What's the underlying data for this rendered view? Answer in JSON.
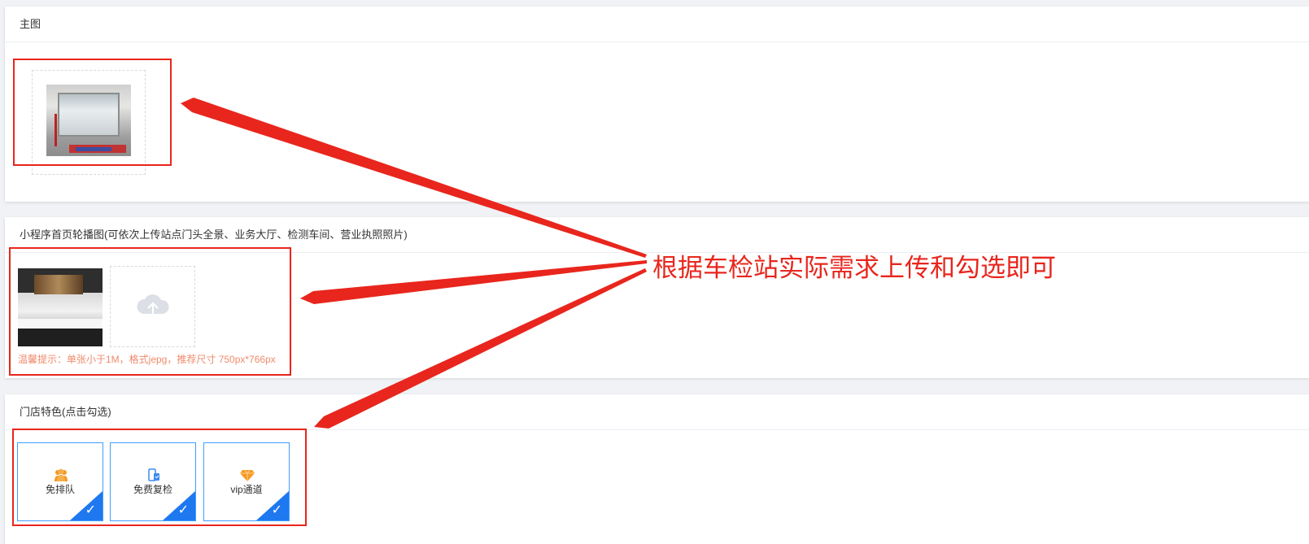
{
  "sections": {
    "main_image": {
      "title": "主图"
    },
    "carousel": {
      "title": "小程序首页轮播图(可依次上传站点门头全景、业务大厅、检测车间、营业执照照片)",
      "hint": "温馨提示：单张小于1M，格式jepg，推荐尺寸 750px*766px"
    },
    "features": {
      "title": "门店特色(点击勾选)",
      "items": [
        {
          "label": "免排队",
          "icon": "people-icon",
          "checked": true
        },
        {
          "label": "免费复检",
          "icon": "phone-document-icon",
          "checked": true
        },
        {
          "label": "vip通道",
          "icon": "diamond-icon",
          "checked": true
        }
      ]
    }
  },
  "annotation": {
    "text": "根据车检站实际需求上传和勾选即可",
    "color": "#e8261d"
  },
  "colors": {
    "accent": "#1e78f0",
    "hint": "#f08a6b",
    "annotation": "#e8261d"
  },
  "icons": {
    "check": "✓"
  }
}
